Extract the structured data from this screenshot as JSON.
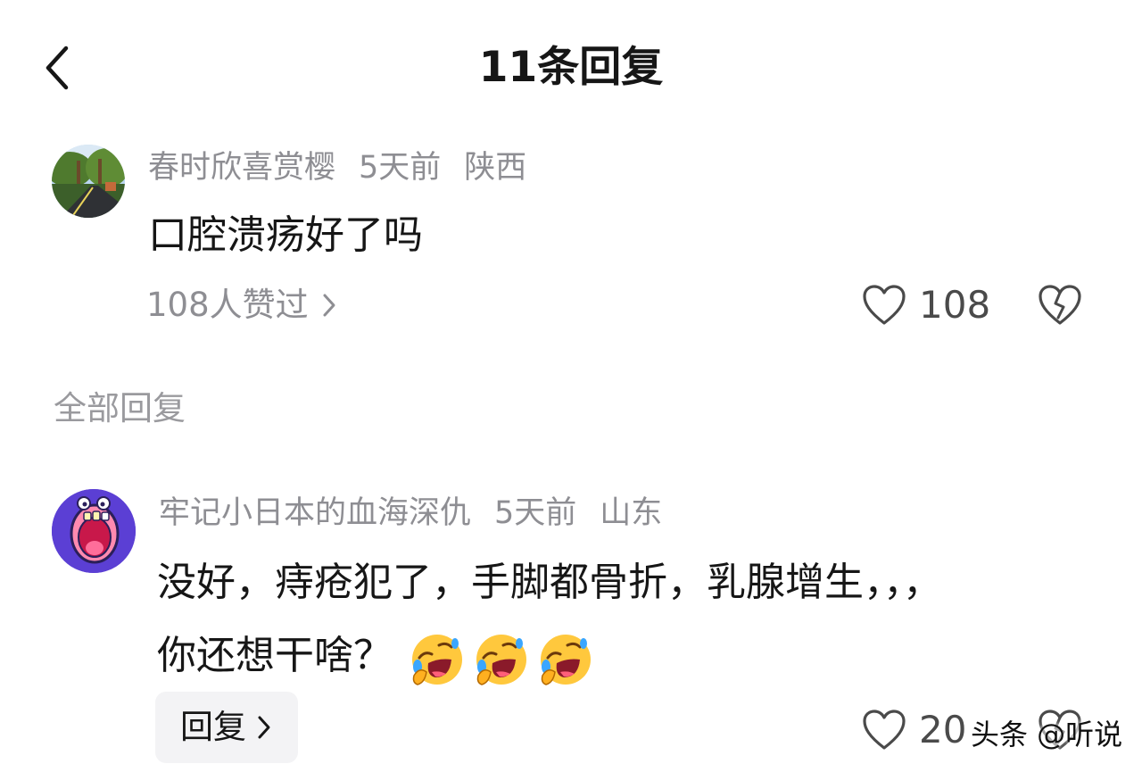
{
  "header": {
    "title": "11条回复",
    "back_icon": "chevron-left-icon"
  },
  "main_comment": {
    "username": "春时欣喜赏樱",
    "time": "5天前",
    "location": "陕西",
    "text": "口腔溃疡好了吗",
    "likes_link": "108人赞过",
    "like_count": "108",
    "like_icon": "heart-outline-icon",
    "dislike_icon": "broken-heart-icon"
  },
  "section": {
    "label": "全部回复"
  },
  "reply": {
    "username": "牢记小日本的血海深仇",
    "time": "5天前",
    "location": "山东",
    "text": "没好，痔疮犯了，手脚都骨折，乳腺增生，，，你还想干啥？",
    "emojis": [
      "rolling-on-floor-laughing-emoji",
      "rolling-on-floor-laughing-emoji",
      "rolling-on-floor-laughing-emoji"
    ],
    "reply_button": "回复",
    "like_count": "20"
  },
  "watermark": "头条 @听说",
  "colors": {
    "title": "#161616",
    "meta": "#8e8e93",
    "text": "#161616",
    "reply_bg": "#f3f3f5",
    "avatar2_bg": "#5b3fd4",
    "emoji_face": "#ffc83d"
  }
}
